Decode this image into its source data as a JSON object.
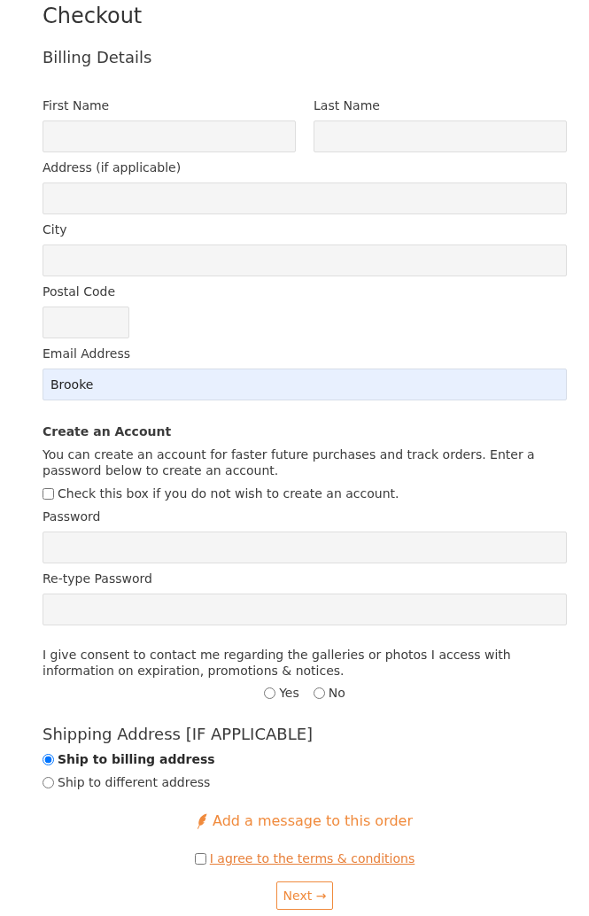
{
  "page": {
    "title": "Checkout"
  },
  "billing": {
    "heading": "Billing Details",
    "fields": [
      {
        "label": "First Name",
        "kind": "half",
        "autofilled": false
      },
      {
        "label": "Last Name",
        "kind": "half",
        "autofilled": false
      },
      {
        "label": "Address (if applicable)",
        "kind": "full",
        "autofilled": false
      },
      {
        "label": "City",
        "kind": "full",
        "autofilled": false
      },
      {
        "label": "Postal Code",
        "kind": "short",
        "autofilled": false
      },
      {
        "label": "Email Address",
        "kind": "full",
        "value": "Brooke",
        "autofilled": true
      }
    ]
  },
  "account": {
    "heading": "Create an Account",
    "text": "You can create an account for faster future purchases and track orders. Enter a password below to create an account.",
    "opt_out": {
      "label": "Check this box if you do not wish to create an account.",
      "checked": false
    },
    "fields": [
      {
        "label": "Password"
      },
      {
        "label": "Re-type Password"
      }
    ]
  },
  "consent": {
    "text": "I give consent to contact me regarding the galleries or photos I access with information on expiration, promotions & notices.",
    "options": [
      {
        "label": "Yes",
        "selected": false
      },
      {
        "label": "No",
        "selected": false
      }
    ]
  },
  "shipping": {
    "heading": "Shipping Address [IF APPLICABLE]",
    "options": [
      {
        "label": "Ship to billing address",
        "selected": true
      },
      {
        "label": "Ship to different address",
        "selected": false
      }
    ]
  },
  "message_link": "Add a message to this order",
  "terms": {
    "label": "I agree to the terms & conditions",
    "checked": false
  },
  "next_button": "Next →"
}
